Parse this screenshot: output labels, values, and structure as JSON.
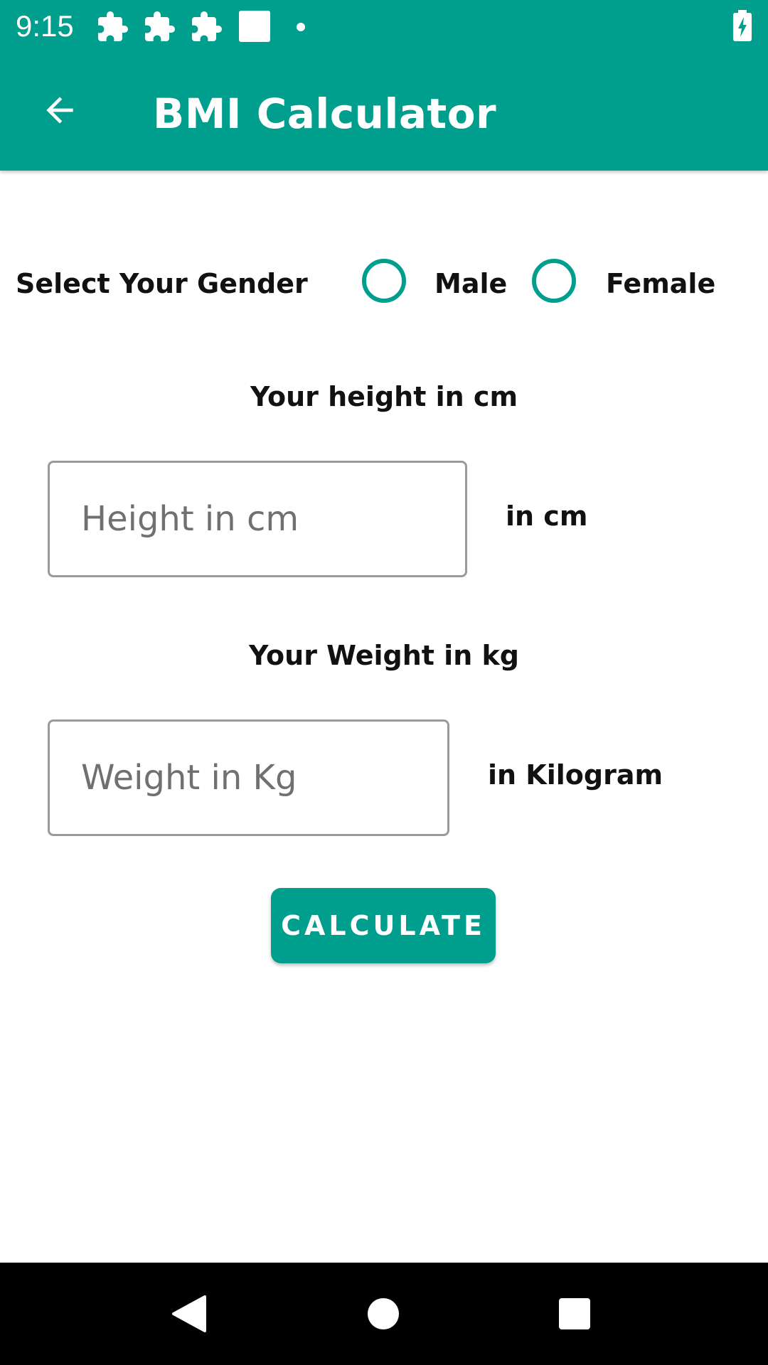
{
  "status_bar": {
    "time": "9:15",
    "notification_icons": [
      "puzzle-icon",
      "puzzle-icon",
      "puzzle-icon",
      "square-icon",
      "dot-icon"
    ],
    "battery_icon": "battery-charging-icon"
  },
  "app_bar": {
    "back_icon": "arrow-left-icon",
    "title": "BMI Calculator"
  },
  "gender": {
    "label": "Select Your Gender",
    "options": [
      {
        "label": "Male",
        "checked": false
      },
      {
        "label": "Female",
        "checked": false
      }
    ]
  },
  "height": {
    "heading": "Your height in cm",
    "value": "",
    "placeholder": "Height in cm",
    "unit_label": "in cm"
  },
  "weight": {
    "heading": "Your Weight in kg",
    "value": "",
    "placeholder": "Weight in Kg",
    "unit_label": "in Kilogram"
  },
  "actions": {
    "calculate_label": "CALCULATE"
  },
  "nav_bar": {
    "buttons": [
      "back-triangle-icon",
      "home-circle-icon",
      "recents-square-icon"
    ]
  },
  "colors": {
    "primary": "#009e8c",
    "background": "#ffffff",
    "text": "#111111",
    "nav_bar": "#000000"
  }
}
